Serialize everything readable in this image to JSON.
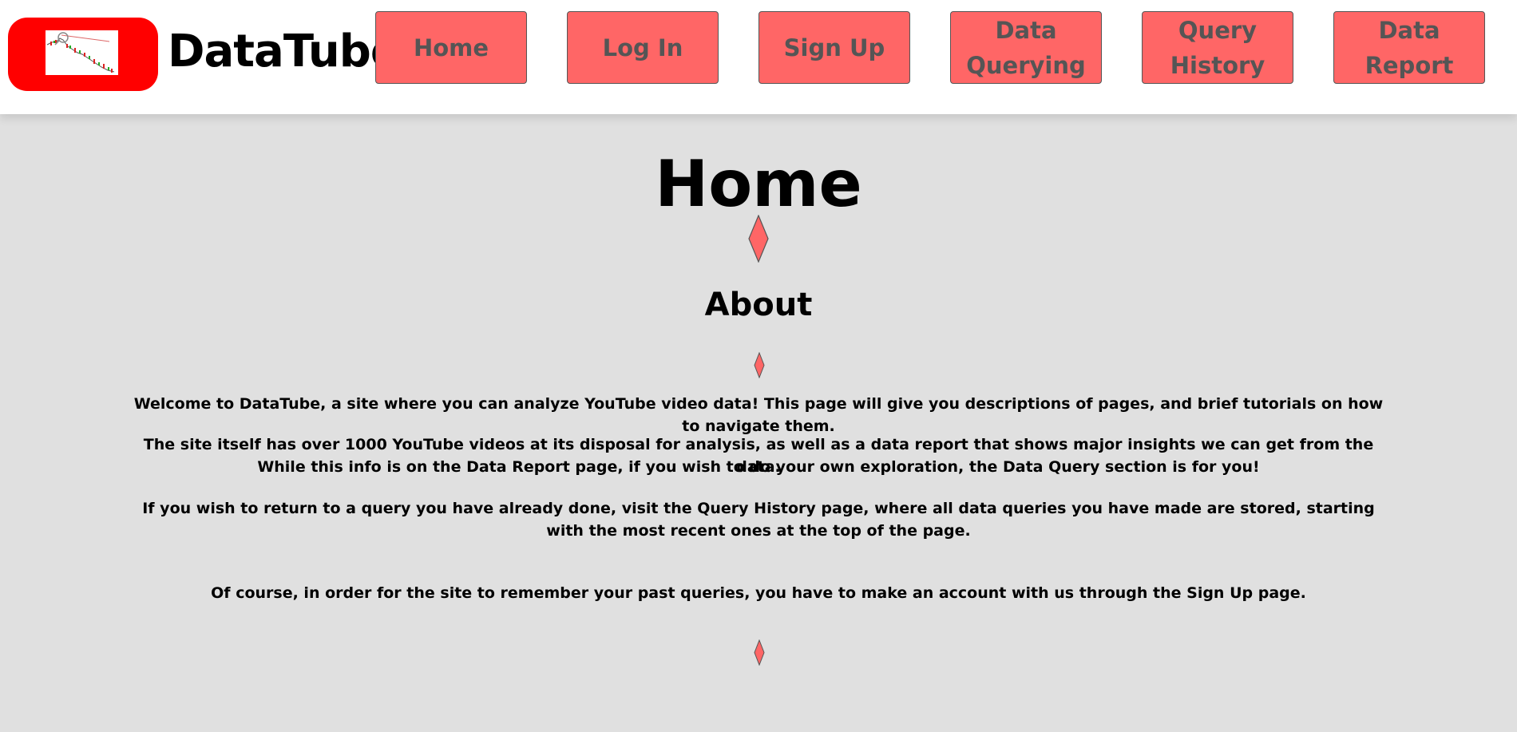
{
  "header": {
    "brand": "DataTube",
    "nav": [
      {
        "line1": "Home",
        "line2": ""
      },
      {
        "line1": "Log In",
        "line2": ""
      },
      {
        "line1": "Sign Up",
        "line2": ""
      },
      {
        "line1": "Data",
        "line2": "Querying"
      },
      {
        "line1": "Query",
        "line2": "History"
      },
      {
        "line1": "Data",
        "line2": "Report"
      }
    ]
  },
  "main": {
    "title": "Home",
    "section_title": "About",
    "paragraphs": {
      "p1": "Welcome to DataTube, a site where you can analyze YouTube video data! This page will give you descriptions of pages, and brief tutorials on how to navigate them.",
      "p2a": "The site itself has over 1000 YouTube videos at its disposal for analysis, as well as a data report that shows major insights we can get from the data.",
      "p2b": "While this info is on the Data Report page, if you wish to do your own exploration, the Data Query section is for you!",
      "p3": "If you wish to return to a query you have already done, visit the Query History page, where all data queries you have made are stored, starting with the most recent ones at the top of the page.",
      "p4": "Of course, in order for the site to remember your past queries, you have to make an account with us through the Sign Up page."
    }
  },
  "colors": {
    "accent": "#ff6666",
    "logo_red": "#ff0000",
    "background": "#e0e0e0",
    "header_bg": "#ffffff"
  }
}
